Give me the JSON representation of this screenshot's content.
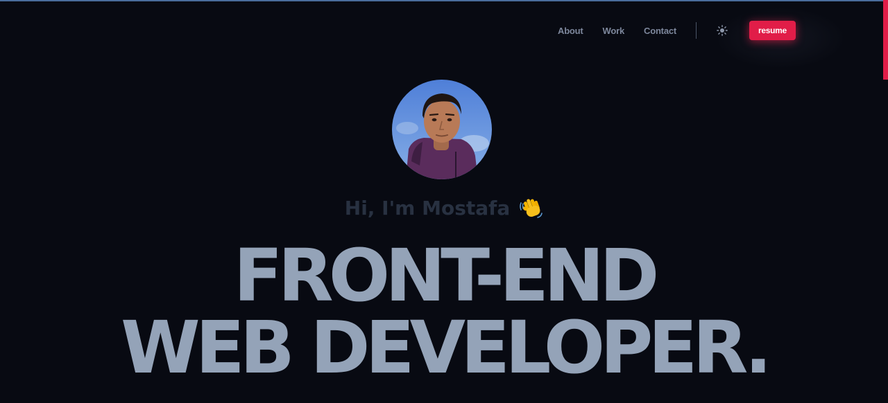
{
  "nav": {
    "links": [
      "About",
      "Work",
      "Contact"
    ],
    "theme_toggle_icon": "sun-icon",
    "resume_label": "resume"
  },
  "hero": {
    "greeting": "Hi, I'm Mostafa",
    "wave_icon": "waving-hand-icon",
    "headline_line1": "FRONT-END",
    "headline_line2": "WEB DEVELOPER."
  },
  "colors": {
    "background": "#080a12",
    "accent": "#e11d48",
    "headline": "#94a3b8",
    "greeting": "#283141",
    "nav_link": "#7d879c"
  }
}
